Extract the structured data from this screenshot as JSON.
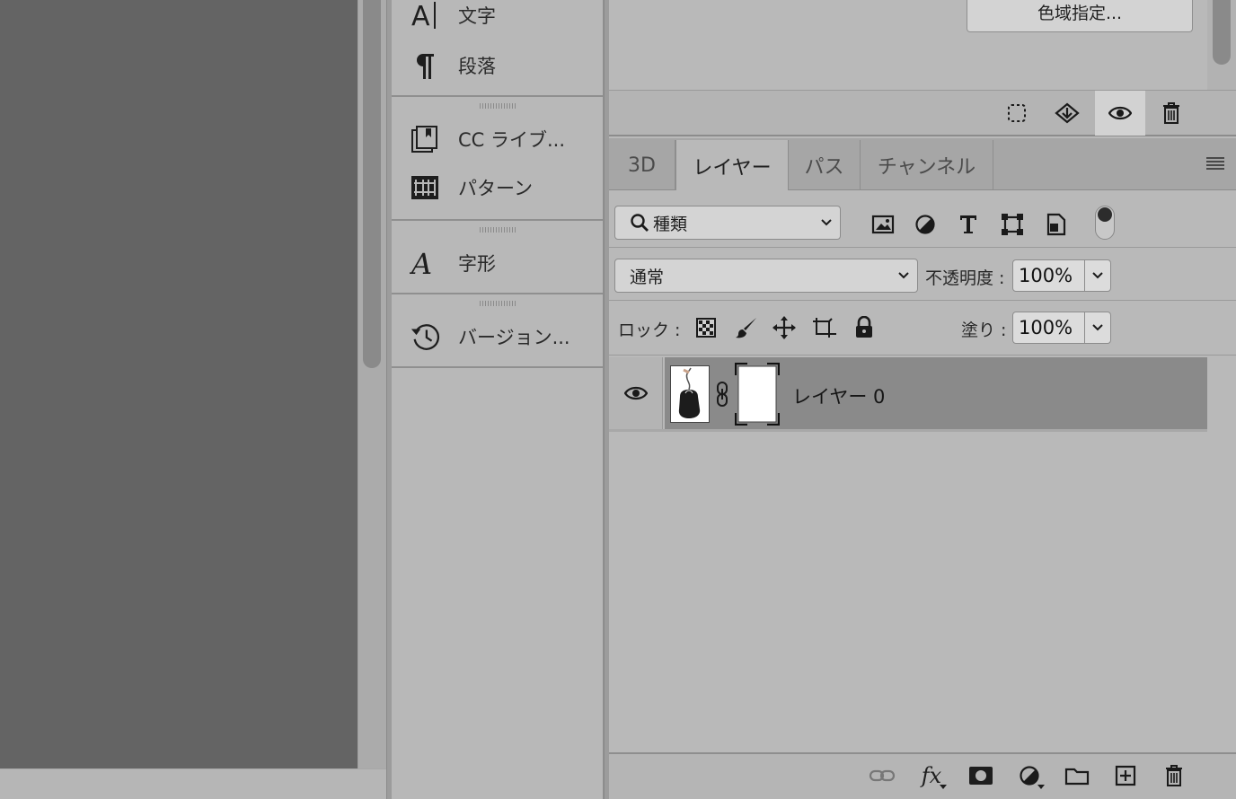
{
  "dock": {
    "items": [
      {
        "label": "文字",
        "icon": "character-icon"
      },
      {
        "label": "段落",
        "icon": "paragraph-icon"
      },
      {
        "label": "CC ライブ...",
        "icon": "cc-libraries-icon"
      },
      {
        "label": "パターン",
        "icon": "patterns-icon"
      },
      {
        "label": "字形",
        "icon": "glyphs-icon"
      },
      {
        "label": "バージョン...",
        "icon": "history-icon"
      }
    ]
  },
  "mask_properties": {
    "color_range_label": "色域指定...",
    "toolbar_icons": [
      "load-selection-icon",
      "apply-mask-icon",
      "visibility-icon",
      "delete-icon"
    ]
  },
  "layers_panel": {
    "tabs": [
      {
        "label": "3D",
        "active": false
      },
      {
        "label": "レイヤー",
        "active": true
      },
      {
        "label": "パス",
        "active": false
      },
      {
        "label": "チャンネル",
        "active": false
      }
    ],
    "filter": {
      "selected": "種類"
    },
    "filter_icons": [
      "image-filter-icon",
      "adjustment-filter-icon",
      "type-filter-icon",
      "shape-filter-icon",
      "smart-object-filter-icon"
    ],
    "blend_mode": "通常",
    "opacity_label": "不透明度 :",
    "opacity_value": "100%",
    "lock_label": "ロック :",
    "lock_icons": [
      "lock-transparency-icon",
      "lock-pixels-icon",
      "lock-position-icon",
      "lock-artboard-icon",
      "lock-all-icon"
    ],
    "fill_label": "塗り :",
    "fill_value": "100%",
    "layers": [
      {
        "name": "レイヤー 0",
        "visible": true,
        "selected": true
      }
    ],
    "bottom_icons": [
      "link-layers-icon",
      "fx-icon",
      "add-mask-icon",
      "adjustment-layer-icon",
      "new-group-icon",
      "new-layer-icon",
      "delete-layer-icon"
    ],
    "fx_label": "fx"
  }
}
